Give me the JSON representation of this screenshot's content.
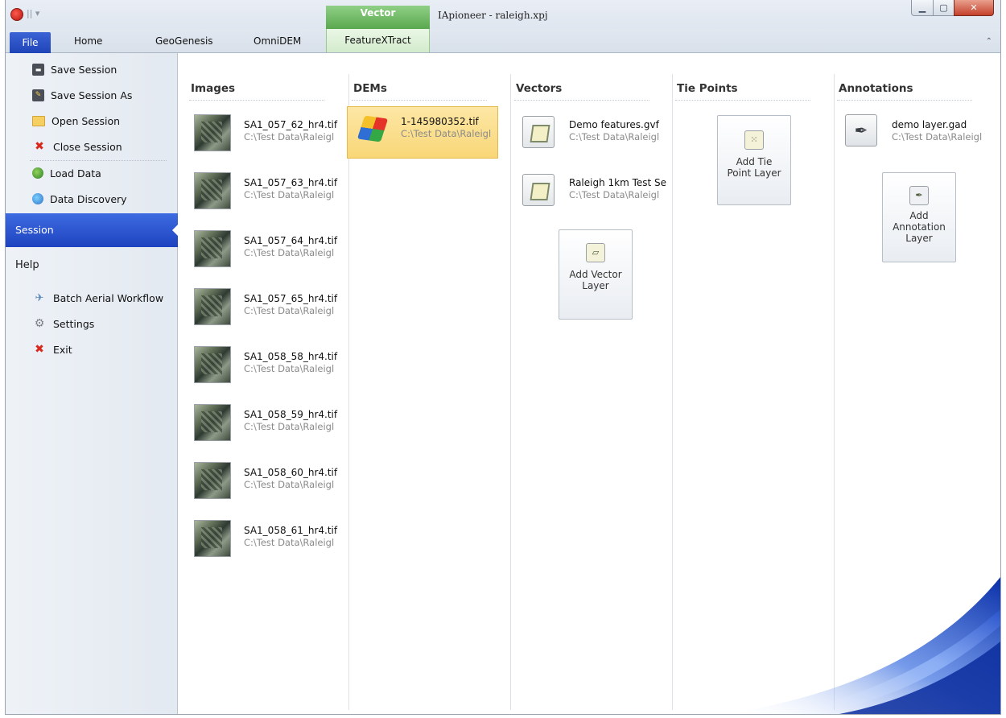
{
  "window": {
    "title": "IApioneer - raleigh.xpj",
    "qat": "|| ▾",
    "contextual_group": "Vector",
    "controls": {
      "minimize": "▁",
      "maximize": "▢",
      "close": "✕"
    },
    "collapse_ribbon": "⌃"
  },
  "tabs": [
    {
      "label": "File"
    },
    {
      "label": "Home"
    },
    {
      "label": "GeoGenesis"
    },
    {
      "label": "OmniDEM"
    },
    {
      "label": "FeatureXTract"
    }
  ],
  "menu": {
    "save_session": "Save Session",
    "save_session_as": "Save Session As",
    "open_session": "Open Session",
    "close_session": "Close Session",
    "load_data": "Load Data",
    "data_discovery": "Data Discovery",
    "session": "Session",
    "help": "Help",
    "batch_aerial": "Batch Aerial Workflow",
    "settings": "Settings",
    "exit": "Exit"
  },
  "columns": {
    "images": "Images",
    "dems": "DEMs",
    "vectors": "Vectors",
    "tie_points": "Tie Points",
    "annotations": "Annotations"
  },
  "images": [
    {
      "name": "SA1_057_62_hr4.tif",
      "path": "C:\\Test Data\\Raleigl"
    },
    {
      "name": "SA1_057_63_hr4.tif",
      "path": "C:\\Test Data\\Raleigl"
    },
    {
      "name": "SA1_057_64_hr4.tif",
      "path": "C:\\Test Data\\Raleigl"
    },
    {
      "name": "SA1_057_65_hr4.tif",
      "path": "C:\\Test Data\\Raleigl"
    },
    {
      "name": "SA1_058_58_hr4.tif",
      "path": "C:\\Test Data\\Raleigl"
    },
    {
      "name": "SA1_058_59_hr4.tif",
      "path": "C:\\Test Data\\Raleigl"
    },
    {
      "name": "SA1_058_60_hr4.tif",
      "path": "C:\\Test Data\\Raleigl"
    },
    {
      "name": "SA1_058_61_hr4.tif",
      "path": "C:\\Test Data\\Raleigl"
    }
  ],
  "dems": [
    {
      "name": "1-145980352.tif",
      "path": "C:\\Test Data\\Raleigl"
    }
  ],
  "vectors": [
    {
      "name": "Demo features.gvf",
      "path": "C:\\Test Data\\Raleigl"
    },
    {
      "name": "Raleigh 1km Test Se",
      "path": "C:\\Test Data\\Raleigl"
    }
  ],
  "annotations": [
    {
      "name": "demo layer.gad",
      "path": "C:\\Test Data\\Raleigl"
    }
  ],
  "buttons": {
    "add_vector_line1": "Add Vector",
    "add_vector_line2": "Layer",
    "add_tie_line1": "Add Tie",
    "add_tie_line2": "Point Layer",
    "add_annot_line1": "Add",
    "add_annot_line2": "Annotation",
    "add_annot_line3": "Layer"
  },
  "colors": {
    "file_tab": "#2648c4",
    "session_highlight": "#2a55d6",
    "selected_item": "#f9d778",
    "contextual_green": "#6bb65f"
  }
}
